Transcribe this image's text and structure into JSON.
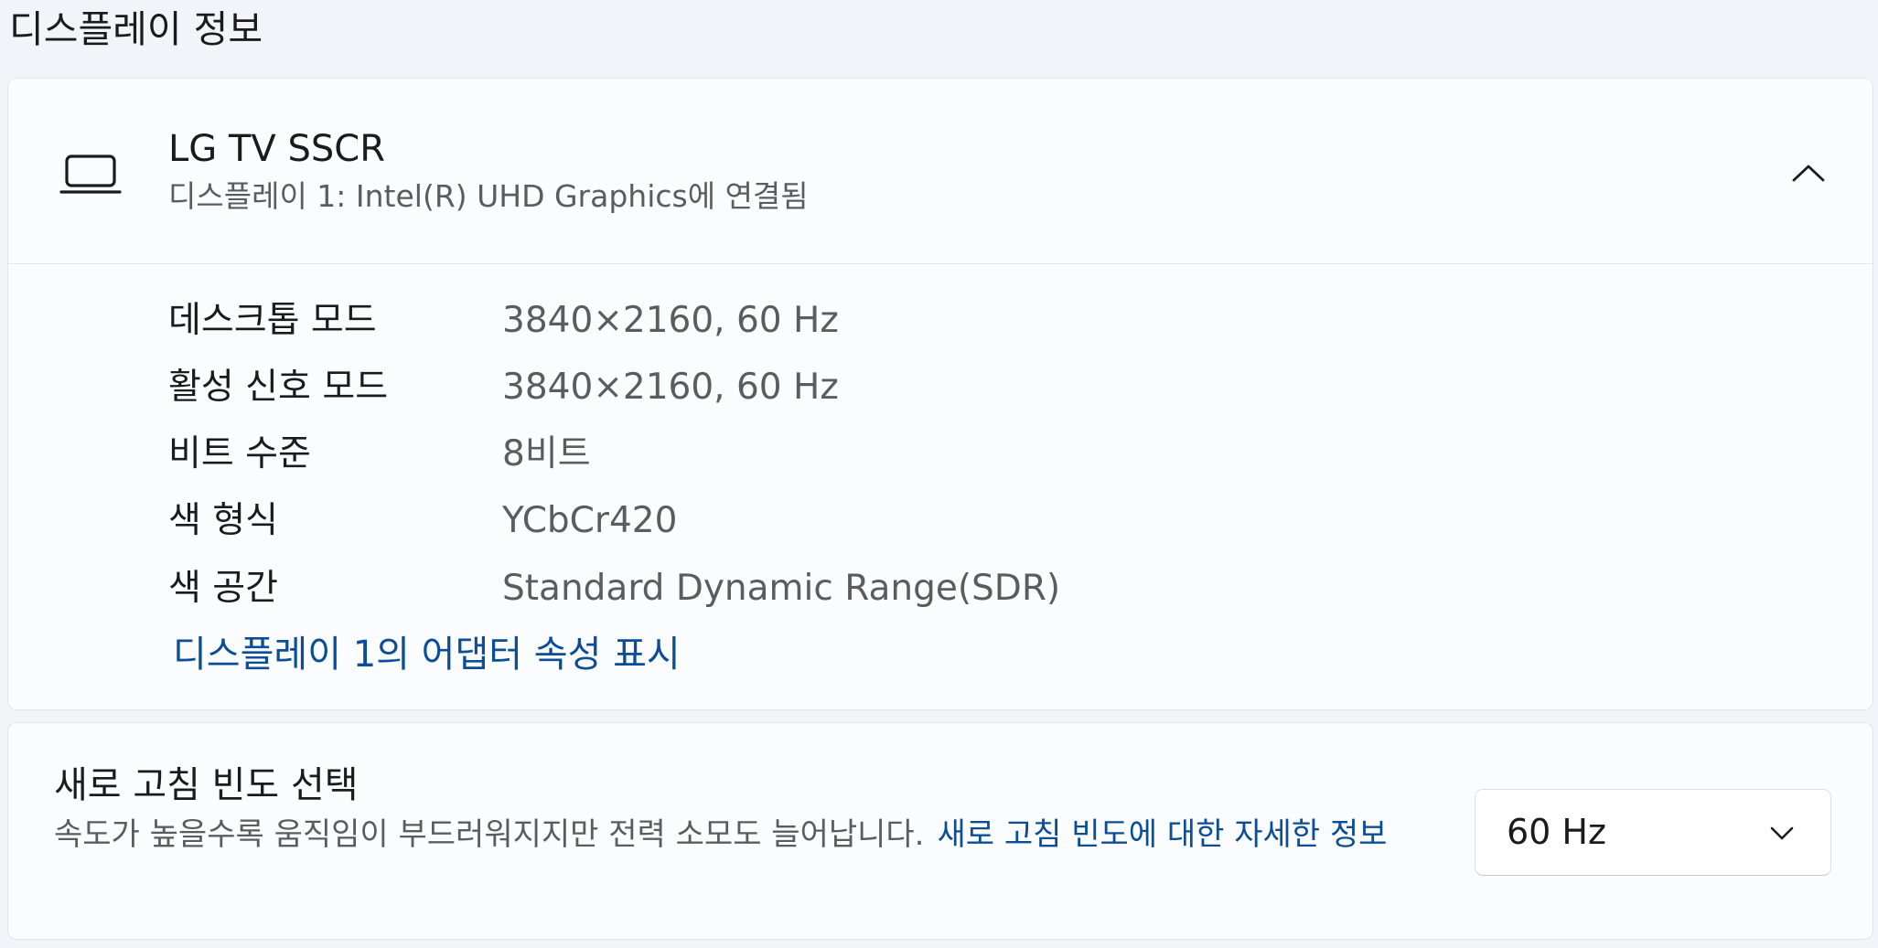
{
  "section_title": "디스플레이 정보",
  "display_card": {
    "icon": "laptop-icon",
    "name": "LG TV SSCR",
    "subtitle": "디스플레이 1: Intel(R) UHD Graphics에 연결됨",
    "collapse_icon": "chevron-up-icon",
    "details": [
      {
        "label": "데스크톱 모드",
        "value": "3840×2160, 60 Hz"
      },
      {
        "label": "활성 신호 모드",
        "value": "3840×2160, 60 Hz"
      },
      {
        "label": "비트 수준",
        "value": "8비트"
      },
      {
        "label": "색 형식",
        "value": "YCbCr420"
      },
      {
        "label": "색 공간",
        "value": "Standard Dynamic Range(SDR)"
      }
    ],
    "adapter_link": "디스플레이 1의 어댑터 속성 표시"
  },
  "refresh_card": {
    "title": "새로 고침 빈도 선택",
    "description": "속도가 높을수록 움직임이 부드러워지지만 전력 소모도 늘어납니다.",
    "learn_more_link": "새로 고침 빈도에 대한 자세한 정보",
    "selected_rate": "60 Hz",
    "dropdown_icon": "chevron-down-icon"
  },
  "colors": {
    "background": "#f1f4f8",
    "card": "#fbfcfe",
    "border": "#e3e6ea",
    "text_primary": "#1b1b1b",
    "text_secondary": "#5c5c5c",
    "link": "#0b4d96"
  }
}
